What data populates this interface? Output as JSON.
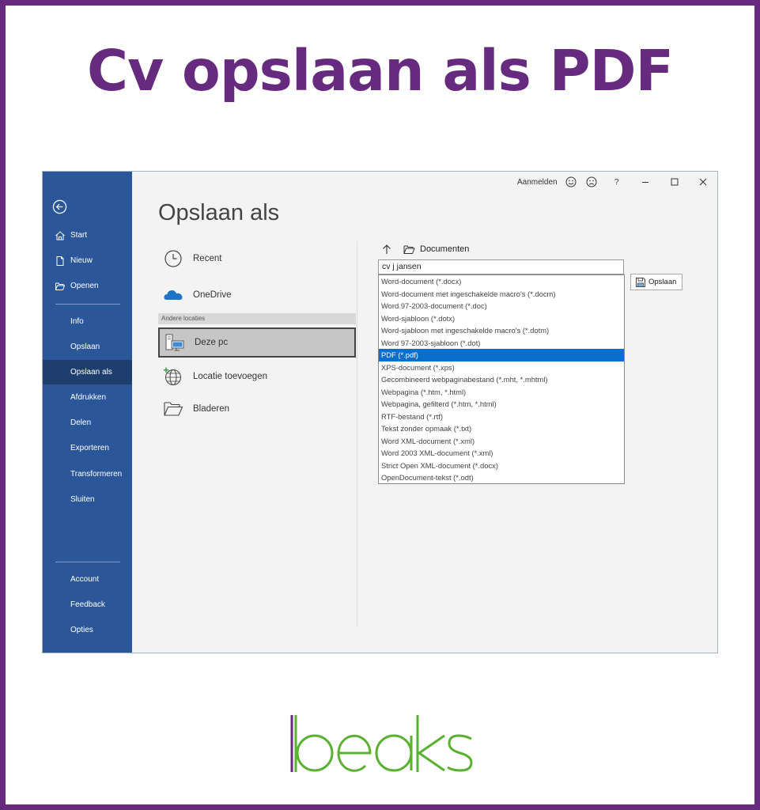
{
  "headline": "Cv opslaan als PDF",
  "colors": {
    "frame": "#662a7e",
    "sidebar": "#2b579a",
    "sidebar_selected": "#1e3e6e",
    "selected_option": "#0a6fcc",
    "logo_green": "#5ab031",
    "logo_purple": "#662a7e"
  },
  "sidebar": {
    "top_items": [
      {
        "label": "Start",
        "icon": "home-icon"
      },
      {
        "label": "Nieuw",
        "icon": "new-document-icon"
      },
      {
        "label": "Openen",
        "icon": "open-folder-icon"
      }
    ],
    "middle_items": [
      "Info",
      "Opslaan",
      "Opslaan als",
      "Afdrukken",
      "Delen",
      "Exporteren",
      "Transformeren",
      "Sluiten"
    ],
    "selected": "Opslaan als",
    "bottom_items": [
      "Account",
      "Feedback",
      "Opties"
    ]
  },
  "titlebar": {
    "signin": "Aanmelden",
    "help": "?"
  },
  "page_title": "Opslaan als",
  "locations": {
    "recent": "Recent",
    "onedrive": "OneDrive",
    "other_header": "Andere locaties",
    "this_pc": "Deze pc",
    "add_location": "Locatie toevoegen",
    "browse": "Bladeren"
  },
  "path": {
    "folder": "Documenten"
  },
  "filename": "cv j jansen",
  "file_types": [
    "Word-document (*.docx)",
    "Word-document met ingeschakelde macro's (*.docm)",
    "Word 97-2003-document (*.doc)",
    "Word-sjabloon (*.dotx)",
    "Word-sjabloon met ingeschakelde macro's (*.dotm)",
    "Word 97-2003-sjabloon (*.dot)",
    "PDF (*.pdf)",
    "XPS-document (*.xps)",
    "Gecombineerd webpaginabestand (*.mht, *.mhtml)",
    "Webpagina (*.htm, *.html)",
    "Webpagina, gefilterd (*.htm, *.html)",
    "RTF-bestand (*.rtf)",
    "Tekst zonder opmaak (*.txt)",
    "Word XML-document (*.xml)",
    "Word 2003 XML-document (*.xml)",
    "Strict Open XML-document (*.docx)",
    "OpenDocument-tekst (*.odt)"
  ],
  "selected_type": "PDF (*.pdf)",
  "save_button": "Opslaan",
  "logo_text": "beaks"
}
